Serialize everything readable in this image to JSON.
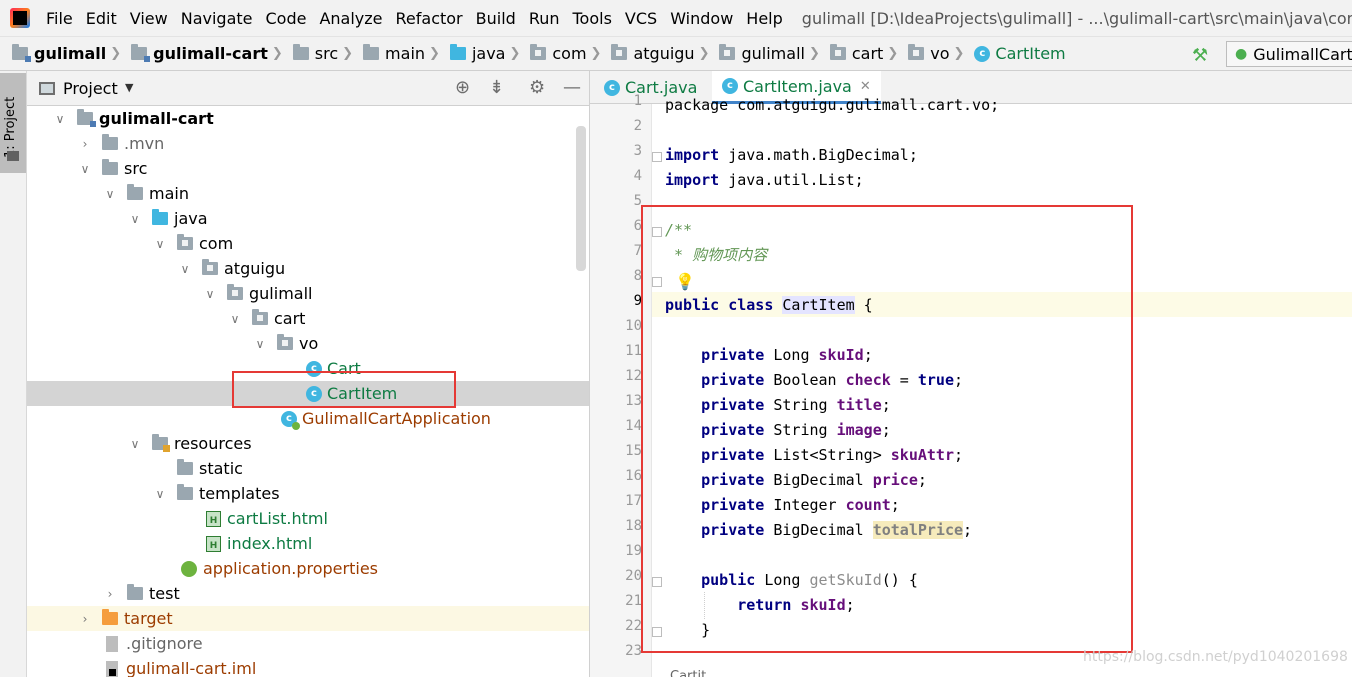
{
  "menubar": {
    "items": [
      "File",
      "Edit",
      "View",
      "Navigate",
      "Code",
      "Analyze",
      "Refactor",
      "Build",
      "Run",
      "Tools",
      "VCS",
      "Window",
      "Help"
    ],
    "window_title": "gulimall [D:\\IdeaProjects\\gulimall] - ...\\gulimall-cart\\src\\main\\java\\com\\atguigu"
  },
  "navbar": {
    "crumbs": [
      "gulimall",
      "gulimall-cart",
      "src",
      "main",
      "java",
      "com",
      "atguigu",
      "gulimall",
      "cart",
      "vo",
      "CartItem"
    ],
    "run_config": "GulimallCartA",
    "hammer_icon": "hammer-icon"
  },
  "tool_strip": {
    "project_label": "1: Project"
  },
  "project_panel": {
    "title": "Project",
    "tree": [
      {
        "label": "gulimall-cart"
      },
      {
        "label": ".mvn"
      },
      {
        "label": "src"
      },
      {
        "label": "main"
      },
      {
        "label": "java"
      },
      {
        "label": "com"
      },
      {
        "label": "atguigu"
      },
      {
        "label": "gulimall"
      },
      {
        "label": "cart"
      },
      {
        "label": "vo"
      },
      {
        "label": "Cart"
      },
      {
        "label": "CartItem"
      },
      {
        "label": "GulimallCartApplication"
      },
      {
        "label": "resources"
      },
      {
        "label": "static"
      },
      {
        "label": "templates"
      },
      {
        "label": "cartList.html"
      },
      {
        "label": "index.html"
      },
      {
        "label": "application.properties"
      },
      {
        "label": "test"
      },
      {
        "label": "target"
      },
      {
        "label": ".gitignore"
      },
      {
        "label": "gulimall-cart.iml"
      }
    ]
  },
  "editor": {
    "tabs": [
      {
        "label": "Cart.java"
      },
      {
        "label": "CartItem.java"
      }
    ],
    "line_numbers": [
      "1",
      "2",
      "3",
      "4",
      "5",
      "6",
      "7",
      "8",
      "9",
      "10",
      "11",
      "12",
      "13",
      "14",
      "15",
      "16",
      "17",
      "18",
      "19",
      "20",
      "21",
      "22",
      "23"
    ],
    "code": {
      "l1": "package com.atguigu.gulimall.cart.vo;",
      "l3_kw": "import",
      "l3_rest": " java.math.BigDecimal;",
      "l4_kw": "import",
      "l4_rest": " java.util.List;",
      "l6": "/**",
      "l7_star": " * ",
      "l7_text": "购物项内容",
      "l9_kw": "public class",
      "l9_name": "CartItem",
      "l9_rest": " {",
      "l11_kw": "private",
      "l11_type": " Long ",
      "l11_field": "skuId",
      "l11_end": ";",
      "l12_kw": "private",
      "l12_type": " Boolean ",
      "l12_field": "check",
      "l12_mid": " = ",
      "l12_val": "true",
      "l12_end": ";",
      "l13_kw": "private",
      "l13_type": " String ",
      "l13_field": "title",
      "l13_end": ";",
      "l14_kw": "private",
      "l14_type": " String ",
      "l14_field": "image",
      "l14_end": ";",
      "l15_kw": "private",
      "l15_type": " List<String> ",
      "l15_field": "skuAttr",
      "l15_end": ";",
      "l16_kw": "private",
      "l16_type": " BigDecimal ",
      "l16_field": "price",
      "l16_end": ";",
      "l17_kw": "private",
      "l17_type": " Integer ",
      "l17_field": "count",
      "l17_end": ";",
      "l18_kw": "private",
      "l18_type": " BigDecimal ",
      "l18_field": "totalPrice",
      "l18_end": ";",
      "l20_kw": "public",
      "l20_type": " Long ",
      "l20_method": "getSkuId",
      "l20_end": "() {",
      "l21_kw": "return",
      "l21_field": " skuId",
      "l21_end": ";",
      "l22": "}"
    }
  },
  "bottom_crumb": "Cartit...",
  "watermark": "https://blog.csdn.net/pyd1040201698",
  "colors": {
    "annotation_red": "#e53935",
    "keyword": "#000080",
    "field": "#660e7a",
    "comment": "#629755",
    "class_file_green": "#0e7b43"
  }
}
